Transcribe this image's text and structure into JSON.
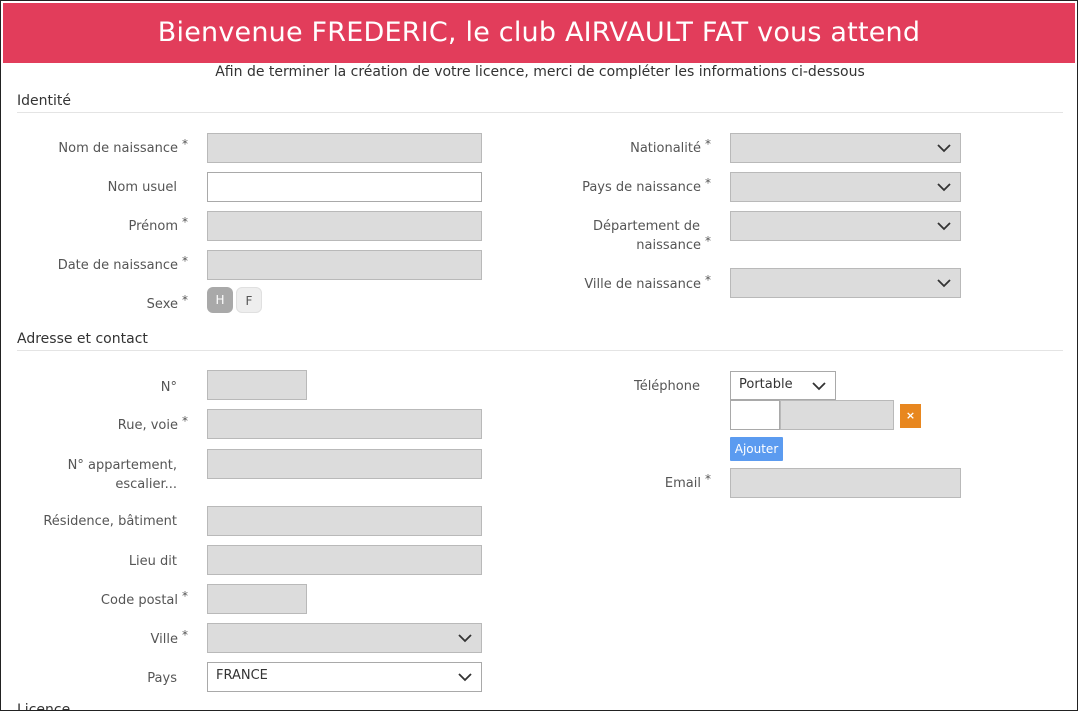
{
  "header": {
    "title": "Bienvenue FREDERIC, le club AIRVAULT FAT vous attend"
  },
  "subtitle": "Afin de terminer la création de votre licence, merci de compléter les informations ci-dessous",
  "sections": {
    "identite": "Identité",
    "adresse": "Adresse et contact",
    "licence_partial": "Licence"
  },
  "identite": {
    "nom_naissance": {
      "label": "Nom de naissance",
      "required": "*",
      "value": ""
    },
    "nom_usuel": {
      "label": "Nom usuel",
      "value": ""
    },
    "prenom": {
      "label": "Prénom",
      "required": "*",
      "value": ""
    },
    "date_naissance": {
      "label": "Date de naissance",
      "required": "*",
      "value": ""
    },
    "sexe": {
      "label": "Sexe",
      "required": "*",
      "options": [
        "H",
        "F"
      ],
      "selected": "H"
    },
    "nationalite": {
      "label": "Nationalité",
      "required": "*",
      "value": ""
    },
    "pays_naissance": {
      "label": "Pays de naissance",
      "required": "*",
      "value": ""
    },
    "departement_naissance": {
      "label_line1": "Département de",
      "label_line2": "naissance",
      "required": "*",
      "value": ""
    },
    "ville_naissance": {
      "label": "Ville de naissance",
      "required": "*",
      "value": ""
    }
  },
  "adresse": {
    "numero": {
      "label": "N°",
      "value": ""
    },
    "rue": {
      "label": "Rue, voie",
      "required": "*",
      "value": ""
    },
    "appartement": {
      "label_line1": "N° appartement,",
      "label_line2": "escalier...",
      "value": ""
    },
    "residence": {
      "label": "Résidence, bâtiment",
      "value": ""
    },
    "lieu_dit": {
      "label": "Lieu dit",
      "value": ""
    },
    "code_postal": {
      "label": "Code postal",
      "required": "*",
      "value": ""
    },
    "ville": {
      "label": "Ville",
      "required": "*",
      "value": ""
    },
    "pays": {
      "label": "Pays",
      "value": "FRANCE"
    }
  },
  "contact": {
    "telephone": {
      "label": "Téléphone",
      "type": "Portable",
      "prefix": "",
      "number": ""
    },
    "add_button": "Ajouter",
    "remove_button": "×",
    "email": {
      "label": "Email",
      "required": "*",
      "value": ""
    }
  },
  "icons": {
    "chevron": "chevron-down-icon",
    "remove": "close-icon"
  },
  "colors": {
    "banner": "#e23d5b",
    "add_button": "#5b9bf0",
    "remove_button": "#e8871f",
    "field_disabled": "#dcdcdc"
  }
}
